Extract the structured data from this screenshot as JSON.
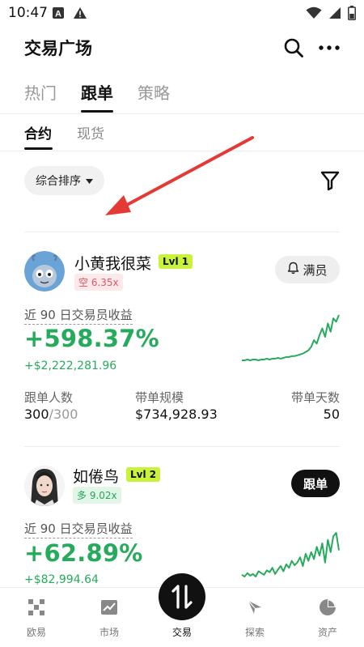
{
  "status": {
    "time": "10:47",
    "left_icons": [
      "a-box-icon",
      "warning-icon"
    ],
    "right_icons": [
      "wifi-icon",
      "signal-icon",
      "battery-icon"
    ]
  },
  "header": {
    "title": "交易广场",
    "icons": [
      "search-icon",
      "more-icon"
    ]
  },
  "tabs": [
    {
      "label": "热门",
      "active": false
    },
    {
      "label": "跟单",
      "active": true
    },
    {
      "label": "策略",
      "active": false
    }
  ],
  "subtabs": [
    {
      "label": "合约",
      "active": true
    },
    {
      "label": "现货",
      "active": false
    }
  ],
  "sort": {
    "label": "综合排序",
    "icon": "caret-down-icon"
  },
  "filter": {
    "icon": "filter-icon"
  },
  "ghost_row": {
    "c1": "",
    "c2": "",
    "c3": ""
  },
  "traders": [
    {
      "name": "小黄我很菜",
      "level": "Lvl 1",
      "side": "空 6.35x",
      "side_type": "short",
      "action": "满员",
      "action_icon": "bell-icon",
      "metric_label": "近 90 日交易员收益",
      "pct": "+598.37%",
      "usd": "+$2,222,281.96",
      "stats": [
        {
          "label": "跟单人数",
          "value": "300",
          "value_suffix": "/300"
        },
        {
          "label": "带单规模",
          "value": "$734,928.93",
          "value_suffix": ""
        },
        {
          "label": "带单天数",
          "value": "50",
          "value_suffix": ""
        }
      ],
      "spark": [
        2,
        2,
        3,
        2,
        3,
        3,
        2,
        3,
        3,
        4,
        3,
        4,
        4,
        5,
        4,
        5,
        6,
        6,
        7,
        7,
        8,
        9,
        10,
        12,
        14,
        18,
        26,
        22,
        32,
        40,
        30,
        46,
        36,
        52,
        48,
        56
      ]
    },
    {
      "name": "如倦鸟",
      "level": "Lvl 2",
      "side": "多 9.02x",
      "side_type": "long",
      "action": "跟单",
      "metric_label": "近 90 日交易员收益",
      "pct": "+62.89%",
      "usd": "+$82,994.64",
      "spark": [
        4,
        2,
        6,
        3,
        5,
        2,
        8,
        6,
        4,
        9,
        7,
        12,
        5,
        10,
        14,
        8,
        16,
        12,
        20,
        15,
        18,
        24,
        14,
        28,
        20,
        30,
        22,
        36,
        26,
        40,
        18,
        44,
        30,
        48,
        52,
        32
      ]
    }
  ],
  "bottom_nav": [
    {
      "label": "欧易",
      "icon": "okx-logo-icon"
    },
    {
      "label": "市场",
      "icon": "chart-icon"
    },
    {
      "label": "交易",
      "icon": "trade-swap-icon",
      "active": true
    },
    {
      "label": "探索",
      "icon": "compass-icon"
    },
    {
      "label": "资产",
      "icon": "pie-chart-icon"
    }
  ],
  "colors": {
    "accent_green": "#26ab5d",
    "level_badge": "#c9f23a",
    "short_red": "#e0566b",
    "annotation_arrow": "#e53935"
  }
}
